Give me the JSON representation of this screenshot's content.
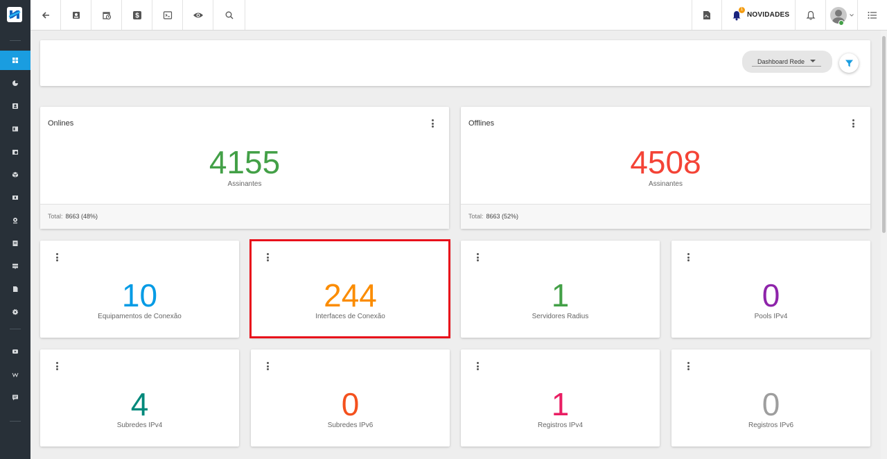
{
  "topbar": {
    "novidades_label": "NOVIDADES",
    "notification_count": "1",
    "icons": [
      "arrow-left-icon",
      "contact-card-icon",
      "calendar-clock-icon",
      "dollar-icon",
      "terminal-icon",
      "eye-icon",
      "search-icon",
      "pdf-file-icon",
      "bell-megaphone-icon",
      "bell-icon",
      "avatar",
      "list-menu-icon"
    ]
  },
  "sidebar": {
    "active_index": 0,
    "items": [
      "dashboard-icon",
      "pie-chart-icon",
      "contact-icon",
      "board-icon",
      "calendar-icon",
      "box-icon",
      "ticket-icon",
      "map-pin-icon",
      "document-icon",
      "server-icon",
      "file-icon",
      "gear-icon",
      "youtube-icon",
      "wiki-icon",
      "chat-icon"
    ]
  },
  "filter": {
    "dashboard_select": "Dashboard Rede"
  },
  "summary": [
    {
      "title": "Onlines",
      "value": "4155",
      "label": "Assinantes",
      "total_label": "Total:",
      "total_value": "8663 (48%)",
      "color": "#43a047"
    },
    {
      "title": "Offlines",
      "value": "4508",
      "label": "Assinantes",
      "total_label": "Total:",
      "total_value": "8663 (52%)",
      "color": "#f44336"
    }
  ],
  "stats": [
    {
      "value": "10",
      "label": "Equipamentos de Conexão",
      "color": "#039be5"
    },
    {
      "value": "244",
      "label": "Interfaces de Conexão",
      "color": "#fb8c00"
    },
    {
      "value": "1",
      "label": "Servidores Radius",
      "color": "#43a047"
    },
    {
      "value": "0",
      "label": "Pools IPv4",
      "color": "#8e24aa"
    },
    {
      "value": "4",
      "label": "Subredes IPv4",
      "color": "#00897b"
    },
    {
      "value": "0",
      "label": "Subredes IPv6",
      "color": "#f4511e"
    },
    {
      "value": "1",
      "label": "Registros IPv4",
      "color": "#e91e63"
    },
    {
      "value": "0",
      "label": "Registros IPv6",
      "color": "#9e9e9e"
    }
  ]
}
